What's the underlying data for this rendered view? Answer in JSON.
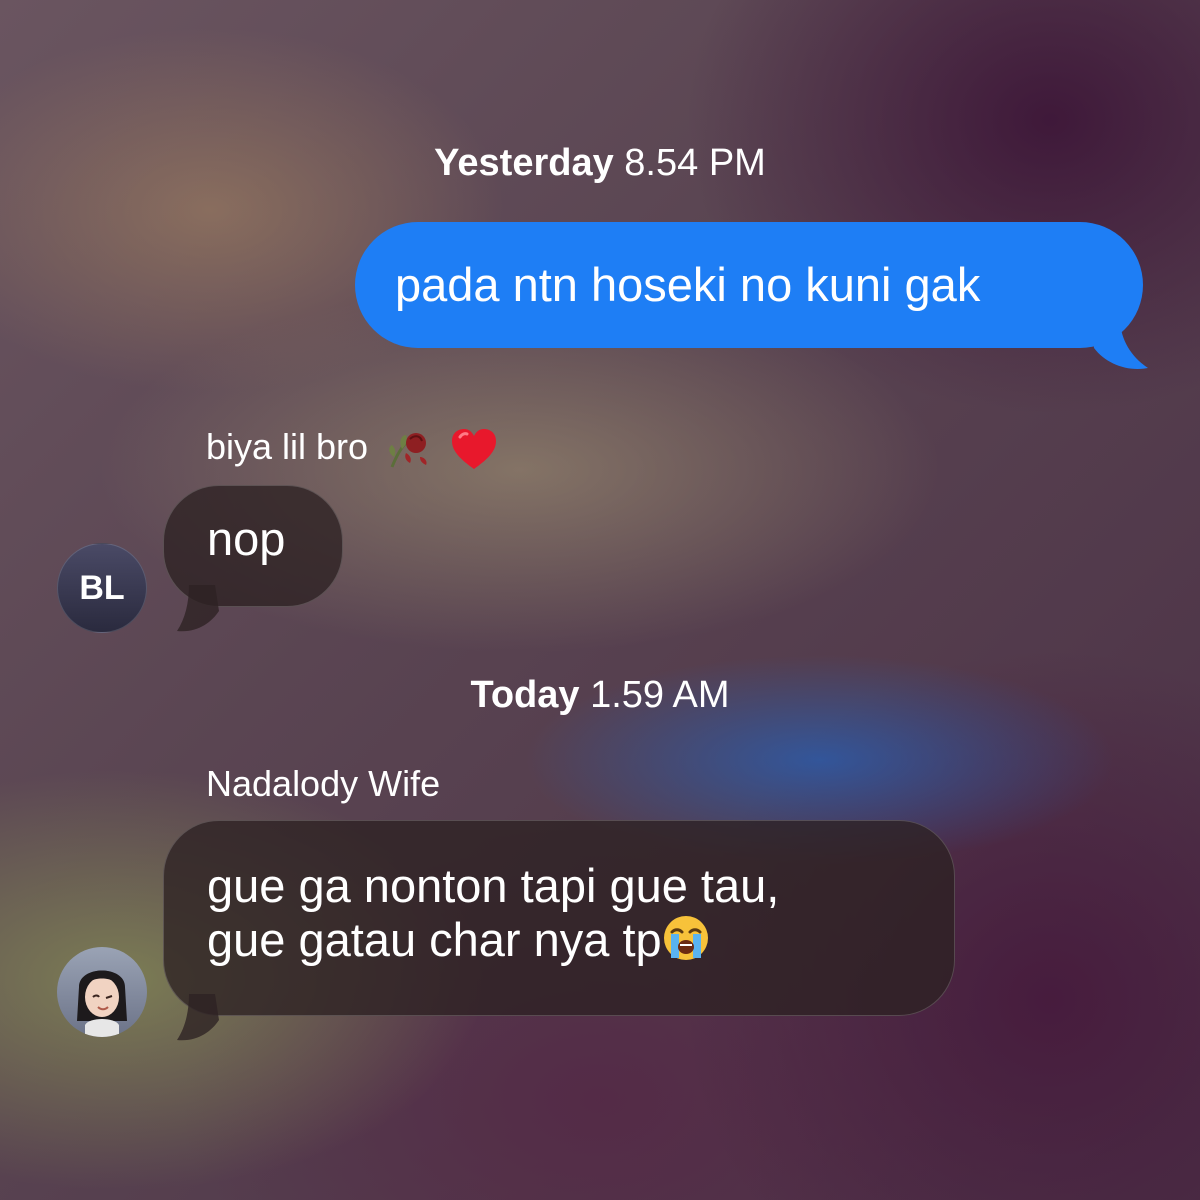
{
  "thread": {
    "divider_1": {
      "day": "Yesterday",
      "time": "8.54 PM"
    },
    "divider_2": {
      "day": "Today",
      "time": "1.59 AM"
    },
    "messages": [
      {
        "direction": "outgoing",
        "text": "pada ntn hoseki no kuni gak",
        "bubble_color": "#1e7ef5"
      },
      {
        "direction": "incoming",
        "sender": "biya lil bro",
        "sender_emoji": [
          "wilted-rose-emoji",
          "red-heart-emoji"
        ],
        "text": "nop",
        "avatar_initials": "BL"
      },
      {
        "direction": "incoming",
        "sender": "Nadalody Wife",
        "text_line_1": "gue ga nonton tapi gue tau,",
        "text_line_2": "gue gatau char nya tp",
        "text_emoji": "loudly-crying-face-emoji",
        "avatar": "memoji-avatar"
      }
    ]
  },
  "colors": {
    "outgoing_bubble": "#1e7ef5",
    "incoming_bubble": "#2d2123",
    "text": "#ffffff"
  }
}
